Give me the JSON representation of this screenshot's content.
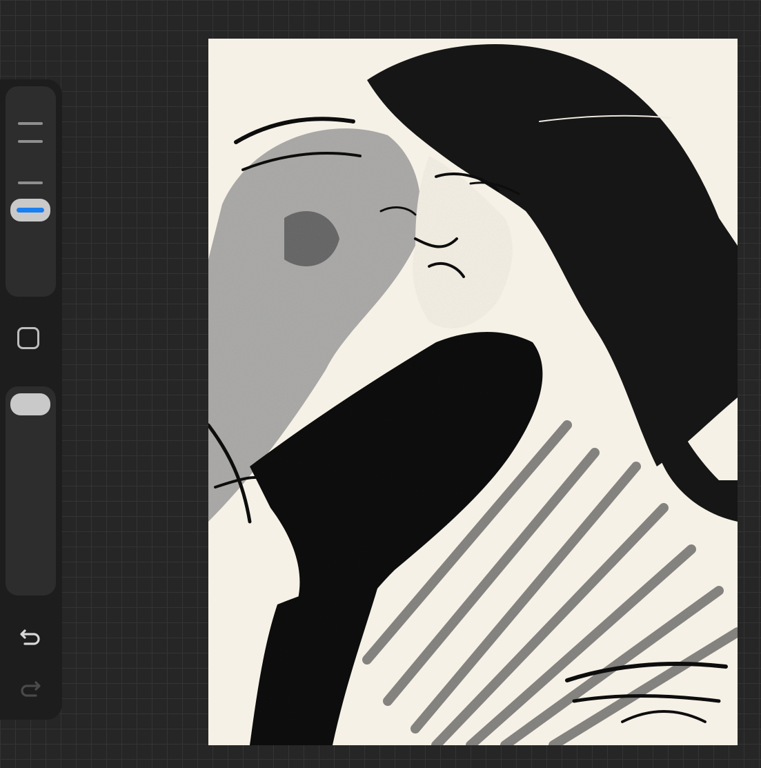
{
  "app": "drawing-app",
  "sidebar": {
    "brush_size_slider": {
      "icon": "brush-size-thumb",
      "accent": "#1a7ff0"
    },
    "modify_button": {
      "icon": "square-outline-icon"
    },
    "opacity_slider": {
      "icon": "opacity-thumb"
    },
    "undo_button": {
      "icon": "undo-arrow-icon"
    },
    "redo_button": {
      "icon": "redo-arrow-icon",
      "disabled": true
    }
  },
  "canvas": {
    "content": "artwork",
    "background": "#f6f1e6",
    "ink": "#111111"
  },
  "colors": {
    "workspace": "#262626",
    "sidebar": "#1d1d1d",
    "slider_track": "#2d2d2d"
  }
}
